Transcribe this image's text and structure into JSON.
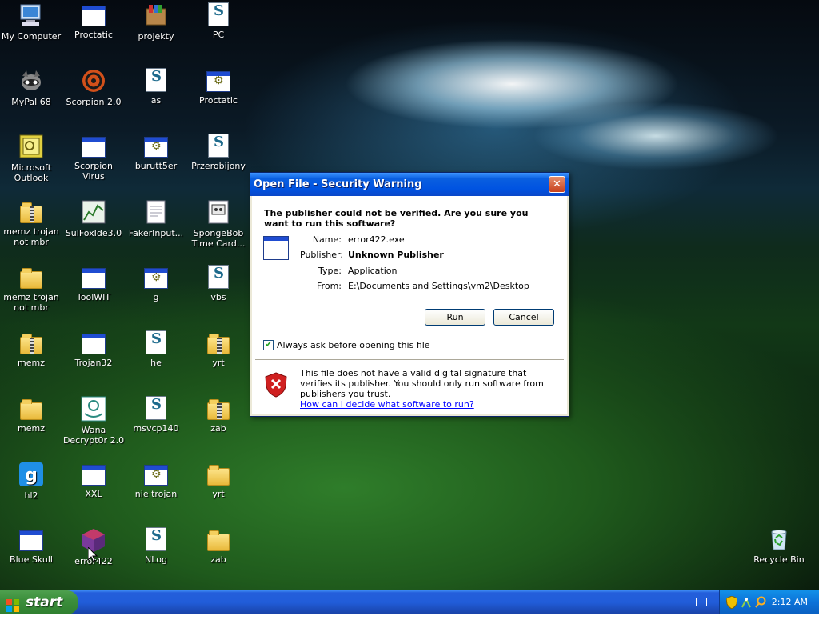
{
  "desktop": {
    "icons": [
      {
        "label": "My Computer",
        "icon": "computer-icon"
      },
      {
        "label": "Proctatic",
        "icon": "window-icon"
      },
      {
        "label": "projekty",
        "icon": "winrar-icon"
      },
      {
        "label": "PC",
        "icon": "script-icon"
      },
      {
        "label": "MyPal 68",
        "icon": "raccoon-icon"
      },
      {
        "label": "Scorpion 2.0",
        "icon": "biohazard-icon"
      },
      {
        "label": "as",
        "icon": "script-icon"
      },
      {
        "label": "Proctatic",
        "icon": "gear-window-icon"
      },
      {
        "label": "Microsoft Outlook",
        "icon": "outlook-icon"
      },
      {
        "label": "Scorpion Virus",
        "icon": "window-icon"
      },
      {
        "label": "burutt5er",
        "icon": "gear-window-icon"
      },
      {
        "label": "Przerobijony",
        "icon": "script-icon"
      },
      {
        "label": "memz trojan not mbr",
        "icon": "zip-folder-icon"
      },
      {
        "label": "SulFoxIde3.0",
        "icon": "chart-icon"
      },
      {
        "label": "FakerInput...",
        "icon": "text-file-icon"
      },
      {
        "label": "SpongeBob Time Card...",
        "icon": "image-file-icon"
      },
      {
        "label": "memz trojan not mbr",
        "icon": "folder-icon"
      },
      {
        "label": "ToolWIT",
        "icon": "window-icon"
      },
      {
        "label": "g",
        "icon": "gear-window-icon"
      },
      {
        "label": "vbs",
        "icon": "script-icon"
      },
      {
        "label": "memz",
        "icon": "zip-folder-icon"
      },
      {
        "label": "Trojan32",
        "icon": "window-icon"
      },
      {
        "label": "he",
        "icon": "script-icon"
      },
      {
        "label": "yrt",
        "icon": "zip-folder-icon"
      },
      {
        "label": "memz",
        "icon": "folder-icon"
      },
      {
        "label": "Wana Decrypt0r 2.0",
        "icon": "wanacry-icon"
      },
      {
        "label": "msvcp140",
        "icon": "script-icon"
      },
      {
        "label": "zab",
        "icon": "zip-folder-icon"
      },
      {
        "label": "hl2",
        "icon": "garrysmod-icon"
      },
      {
        "label": "XXL",
        "icon": "window-icon"
      },
      {
        "label": "nie trojan",
        "icon": "gear-window-icon"
      },
      {
        "label": "yrt",
        "icon": "folder-icon"
      },
      {
        "label": "Blue Skull",
        "icon": "window-icon"
      },
      {
        "label": "error422",
        "icon": "cube-icon"
      },
      {
        "label": "NLog",
        "icon": "script-icon"
      },
      {
        "label": "zab",
        "icon": "folder-icon"
      }
    ],
    "recycle_bin": {
      "label": "Recycle Bin",
      "icon": "recycle-bin-icon"
    }
  },
  "dialog": {
    "title": "Open File - Security Warning",
    "question": "The publisher could not be verified.  Are you sure you want to run this software?",
    "fields": [
      {
        "label": "Name:",
        "value": "error422.exe"
      },
      {
        "label": "Publisher:",
        "value": "Unknown Publisher"
      },
      {
        "label": "Type:",
        "value": "Application"
      },
      {
        "label": "From:",
        "value": "E:\\Documents and Settings\\vm2\\Desktop"
      }
    ],
    "run_label": "Run",
    "cancel_label": "Cancel",
    "checkbox_label": "Always ask before opening this file",
    "checkbox_checked": true,
    "warning_text": "This file does not have a valid digital signature that verifies its publisher.  You should only run software from publishers you trust.",
    "warning_link": "How can I decide what software to run?"
  },
  "taskbar": {
    "start_label": "start",
    "clock": "2:12 AM"
  },
  "colors": {
    "titlebar": "#0053e1",
    "start_button": "#3c8f3c",
    "link": "#0000ff"
  }
}
